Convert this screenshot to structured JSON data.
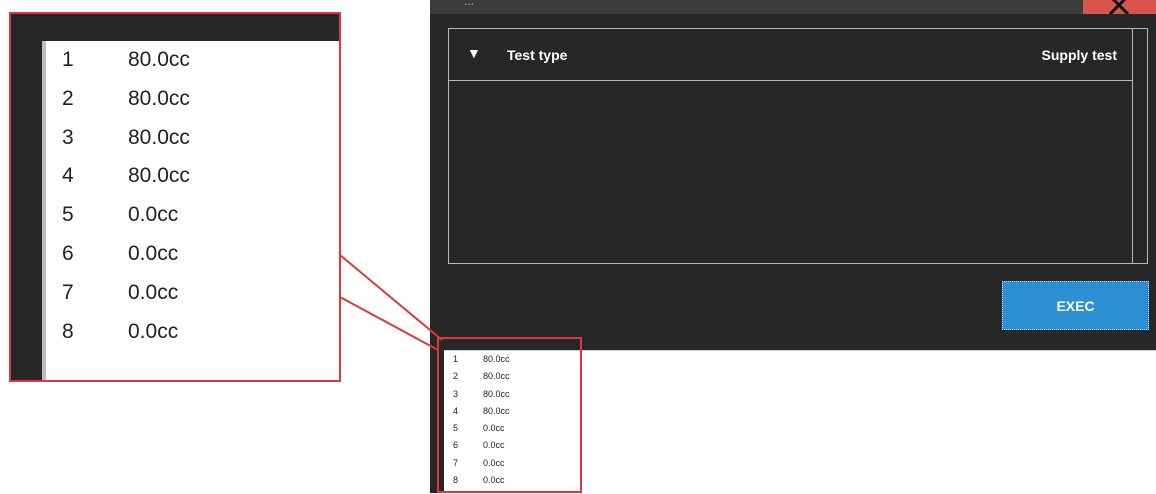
{
  "window": {
    "title_fragment": "...",
    "close_icon": "close-icon"
  },
  "panel": {
    "toggle_icon": "▼",
    "label": "Test type",
    "value": "Supply test"
  },
  "exec_button": {
    "label": "EXEC"
  },
  "log": {
    "rows": [
      {
        "index": "1",
        "value": "80.0cc"
      },
      {
        "index": "2",
        "value": "80.0cc"
      },
      {
        "index": "3",
        "value": "80.0cc"
      },
      {
        "index": "4",
        "value": "80.0cc"
      },
      {
        "index": "5",
        "value": "0.0cc"
      },
      {
        "index": "6",
        "value": "0.0cc"
      },
      {
        "index": "7",
        "value": "0.0cc"
      },
      {
        "index": "8",
        "value": "0.0cc"
      }
    ]
  },
  "colors": {
    "background": "#262727",
    "accent": "#2d8fd3",
    "highlight": "#e0363c",
    "close": "#d9534f"
  }
}
